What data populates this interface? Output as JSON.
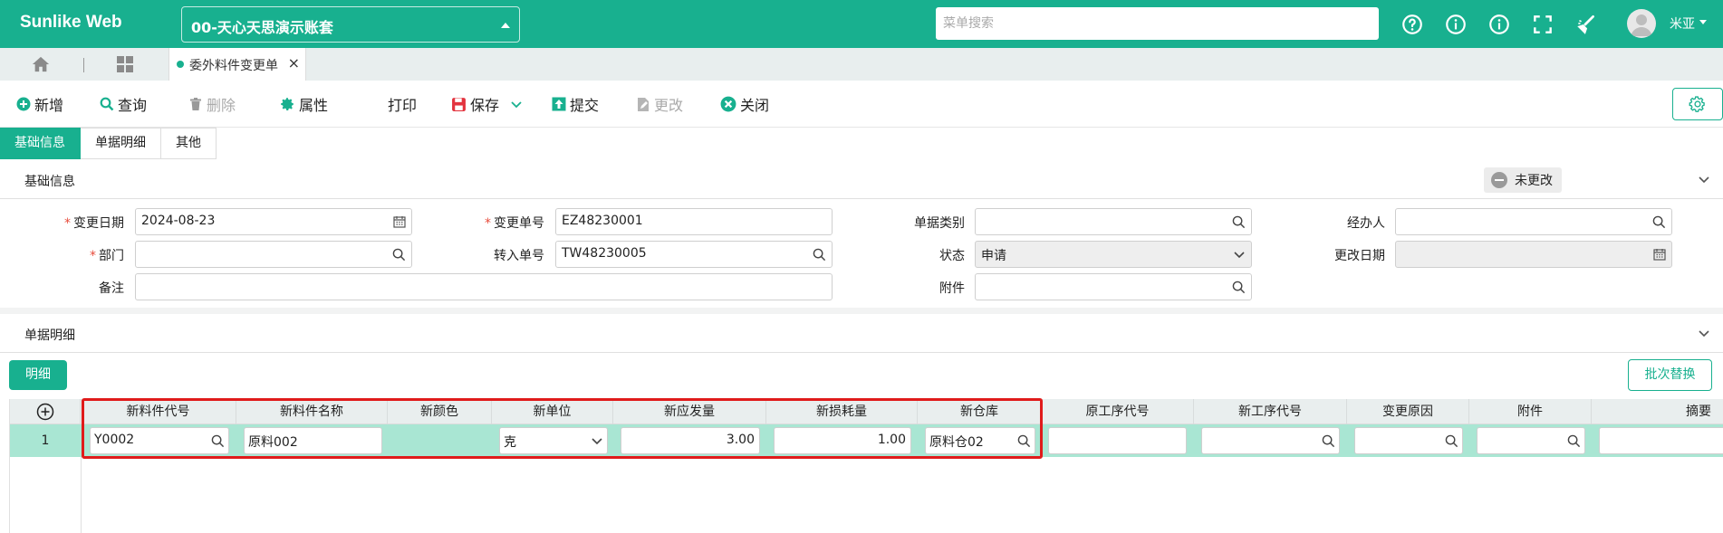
{
  "header": {
    "brand": "Sunlike Web",
    "company": "00-天心天思演示账套",
    "search_placeholder": "菜单搜索",
    "user_name": "米亚",
    "colors": {
      "primary": "#18b08f",
      "highlight": "#e01b1b"
    },
    "icons": [
      "help-icon",
      "info-icon",
      "about-icon",
      "fullscreen-icon",
      "clean-icon",
      "user-avatar-icon"
    ]
  },
  "tabs": {
    "home_icon": "home-icon",
    "apps_icon": "apps-grid-icon",
    "active_tab": "委外料件变更单"
  },
  "toolbar": {
    "add": "新增",
    "query": "查询",
    "delete": "删除",
    "properties": "属性",
    "print": "打印",
    "save": "保存",
    "submit": "提交",
    "modify": "更改",
    "close": "关闭"
  },
  "section_tabs": [
    "基础信息",
    "单据明细",
    "其他"
  ],
  "basic_info": {
    "title": "基础信息",
    "status_badge": "未更改",
    "fields": {
      "change_date_label": "变更日期",
      "change_date": "2024-08-23",
      "change_no_label": "变更单号",
      "change_no": "EZ48230001",
      "doc_type_label": "单据类别",
      "doc_type": "",
      "handler_label": "经办人",
      "handler": "",
      "department_label": "部门",
      "department": "",
      "transfer_no_label": "转入单号",
      "transfer_no": "TW48230005",
      "status_label": "状态",
      "status": "申请",
      "modify_date_label": "更改日期",
      "modify_date": "",
      "remark_label": "备注",
      "remark": "",
      "attachment_label": "附件",
      "attachment": ""
    }
  },
  "detail": {
    "title": "单据明细",
    "detail_button": "明细",
    "batch_replace_button": "批次替换",
    "columns": [
      "新料件代号",
      "新料件名称",
      "新颜色",
      "新单位",
      "新应发量",
      "新损耗量",
      "新仓库",
      "原工序代号",
      "新工序代号",
      "变更原因",
      "附件",
      "摘要"
    ],
    "rows": [
      {
        "no": "1",
        "new_item_code": "Y0002",
        "new_item_name": "原料002",
        "new_color": "",
        "new_unit": "克",
        "new_issue_qty": "3.00",
        "new_loss_qty": "1.00",
        "new_warehouse": "原料仓02",
        "orig_process_code": "",
        "new_process_code": "",
        "change_reason": "",
        "attachment": "",
        "summary": ""
      }
    ]
  }
}
